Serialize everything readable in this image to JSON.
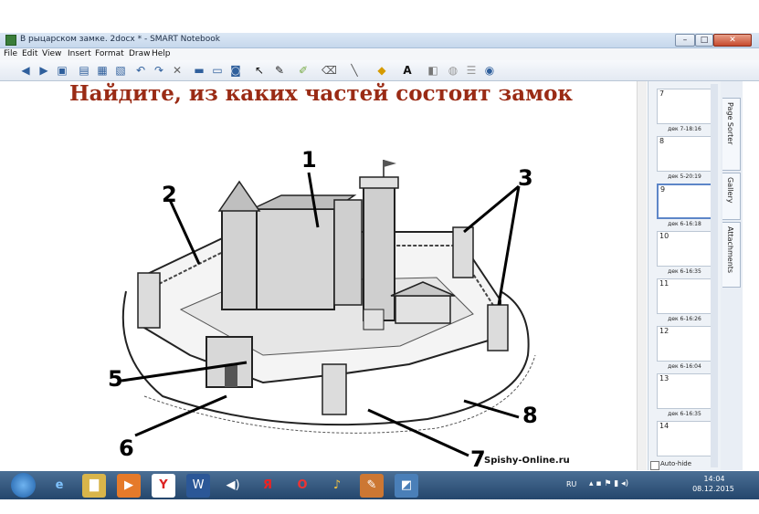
{
  "window": {
    "title": "В рыцарском замке. 2docx * - SMART Notebook",
    "minimize": "–",
    "maximize": "□",
    "close": "✕"
  },
  "menu": [
    "File",
    "Edit",
    "View",
    "Insert",
    "Format",
    "Draw",
    "Help"
  ],
  "toolbar_icons": [
    "back-icon",
    "forward-icon",
    "add-page-icon",
    "delete-page-icon",
    "open-icon",
    "save-icon",
    "paste-icon",
    "undo-icon",
    "redo-icon",
    "delete-icon",
    "screen-shade-icon",
    "full-screen-icon",
    "document-camera-icon",
    "select-icon",
    "pen-icon",
    "creative-pen-icon",
    "eraser-icon",
    "line-icon",
    "shape-icon",
    "text-icon",
    "fill-icon",
    "properties-icon",
    "more-icon"
  ],
  "page": {
    "heading": "Найдите, из каких частей состоит замок",
    "labels": {
      "l1": "1",
      "l2": "2",
      "l3": "3",
      "l5": "5",
      "l6": "6",
      "l7": "7",
      "l8": "8"
    },
    "watermark": "Spishy-Online.ru"
  },
  "sorter": {
    "pages": [
      {
        "num": "7",
        "caption": "дек 7-18:16"
      },
      {
        "num": "8",
        "caption": "дек 5-20:19"
      },
      {
        "num": "9",
        "caption": "дек 6-16:18"
      },
      {
        "num": "10",
        "caption": "дек 6-16:35"
      },
      {
        "num": "11",
        "caption": "дек 6-16:26"
      },
      {
        "num": "12",
        "caption": "дек 6-16:04"
      },
      {
        "num": "13",
        "caption": "дек 6-16:35"
      },
      {
        "num": "14",
        "caption": ""
      }
    ],
    "autohide": "Auto-hide"
  },
  "side_tabs": [
    "Page Sorter",
    "Gallery",
    "Attachments"
  ],
  "taskbar": {
    "apps": [
      "ie-icon",
      "explorer-icon",
      "media-player-icon",
      "yandex-browser-icon",
      "word-icon",
      "volume-app-icon",
      "yandex-icon",
      "opera-icon",
      "winamp-icon",
      "smart-notebook-icon",
      "smart-tools-icon"
    ],
    "lang": "RU",
    "time": "14:04",
    "date": "08.12.2015"
  },
  "colors": {
    "heading": "#9a2b15",
    "taskbar": "#24466c",
    "accent": "#5d86c8"
  }
}
